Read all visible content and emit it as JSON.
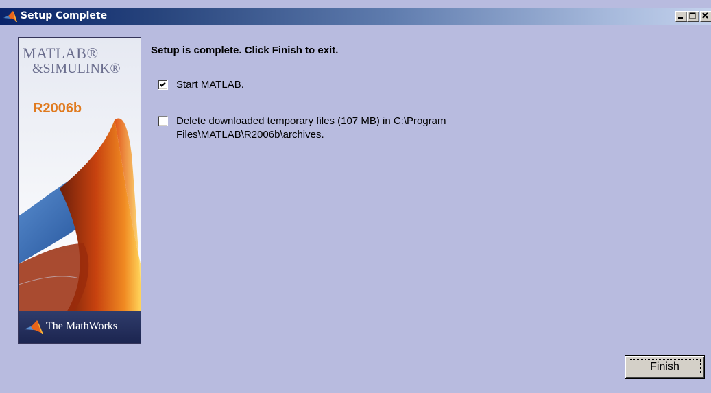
{
  "window": {
    "title": "Setup Complete",
    "title_gradient": [
      "#0a246a",
      "#a5b8db"
    ],
    "background": "#b8bbdf",
    "controls": [
      "minimize-icon",
      "maximize-icon",
      "close-icon"
    ]
  },
  "banner": {
    "product_line1": "MATLAB®",
    "product_line2": "&SIMULINK®",
    "release": "R2006b",
    "release_color": "#e07a1e",
    "vendor": "The MathWorks"
  },
  "main": {
    "heading": "Setup is complete.  Click Finish to exit.",
    "options": [
      {
        "label": "Start MATLAB.",
        "checked": true
      },
      {
        "label": "Delete downloaded temporary files (107 MB) in C:\\Program Files\\MATLAB\\R2006b\\archives.",
        "checked": false
      }
    ]
  },
  "footer": {
    "finish_label": "Finish"
  }
}
